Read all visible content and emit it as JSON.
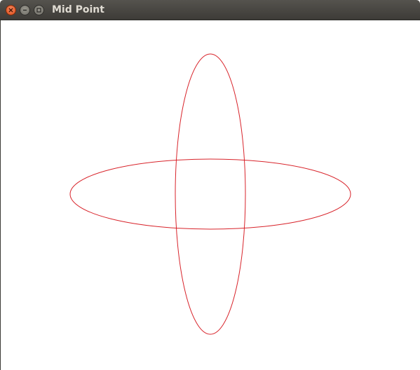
{
  "window": {
    "title": "Mid Point"
  },
  "controls": {
    "close_icon": "close-icon",
    "minimize_icon": "minimize-icon",
    "maximize_icon": "maximize-icon"
  },
  "canvas": {
    "background": "#ffffff",
    "stroke_color": "#d8232a",
    "shapes": [
      {
        "type": "ellipse",
        "orientation": "horizontal"
      },
      {
        "type": "ellipse",
        "orientation": "vertical"
      }
    ]
  },
  "colors": {
    "titlebar": "#3d3b37",
    "title_text": "#dfdbd2",
    "close_button": "#df4a16"
  }
}
